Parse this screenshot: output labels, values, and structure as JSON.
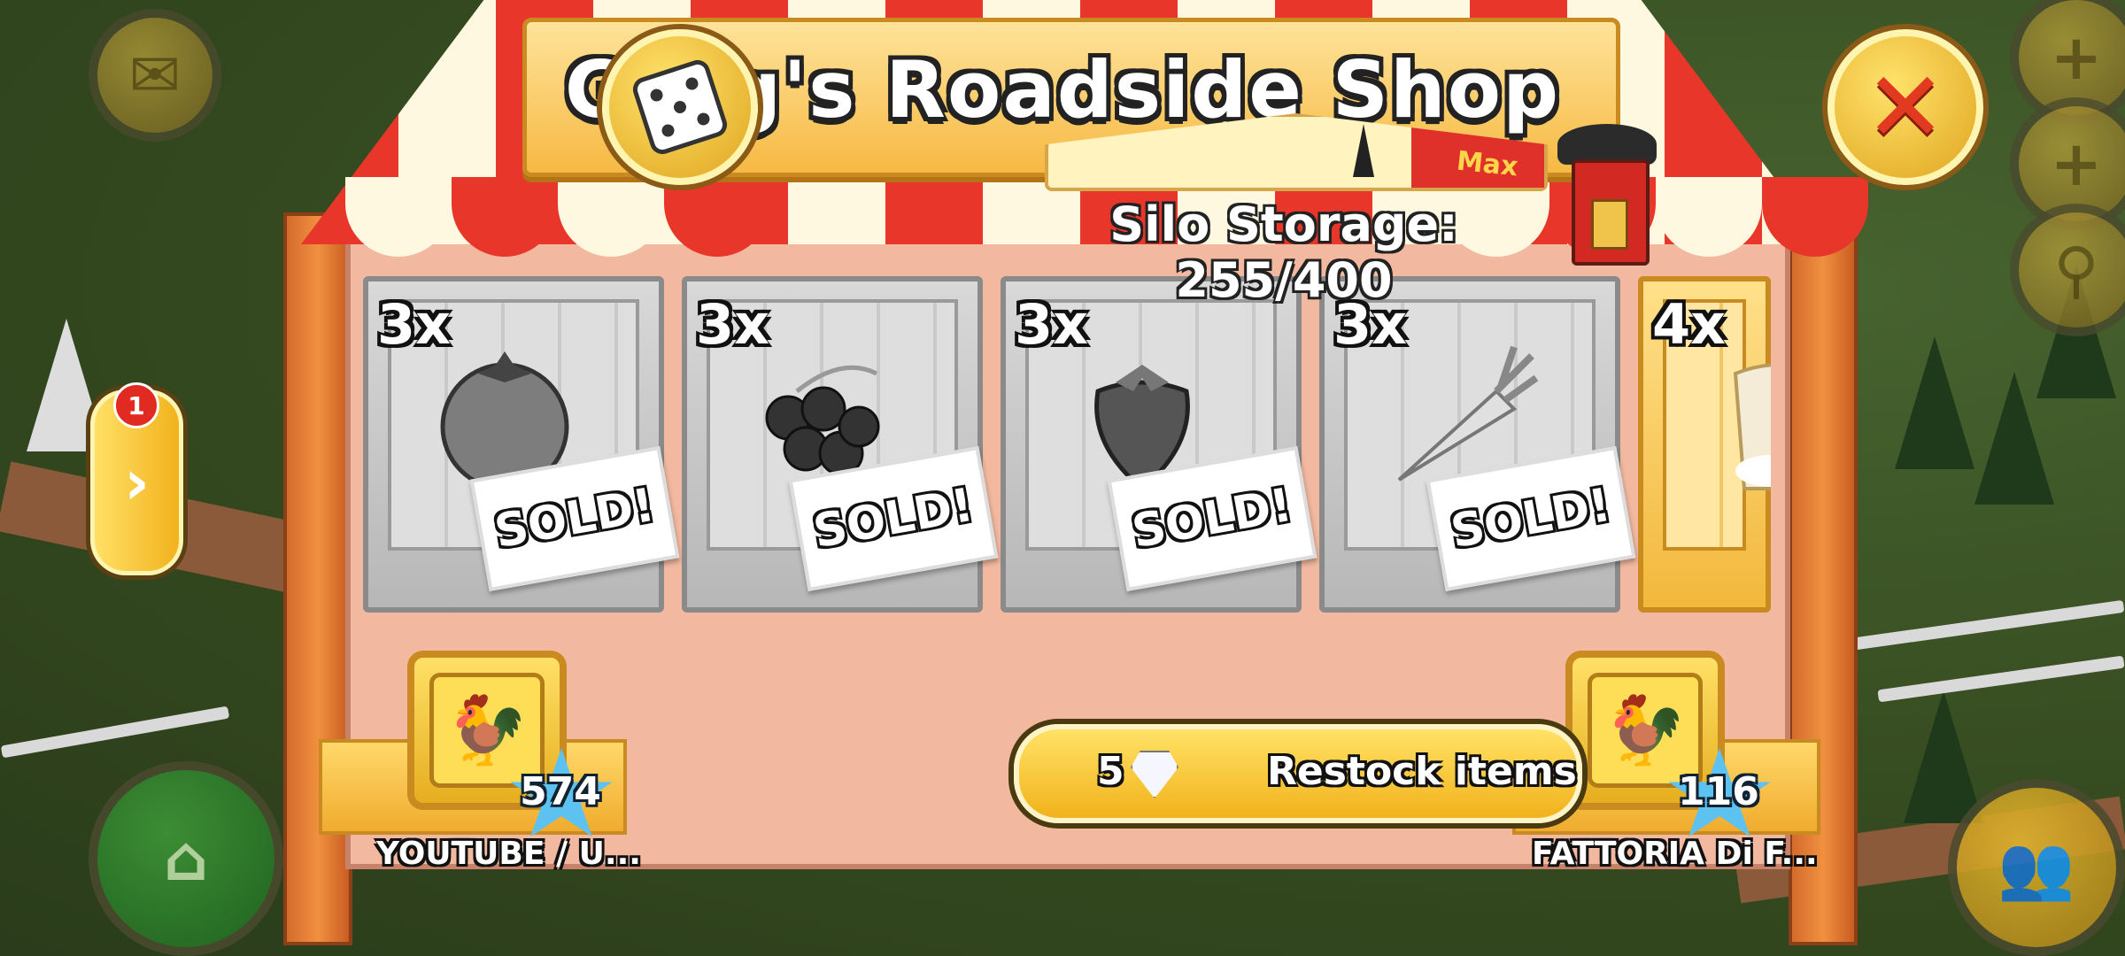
{
  "shop": {
    "title": "Greg's Roadside Shop",
    "silo_label": "Silo Storage: 255/400",
    "gauge_max_label": "Max",
    "silo_fill_fraction": 0.6375
  },
  "crates": [
    {
      "qty": "3x",
      "item": "tomato-icon",
      "status": "SOLD!",
      "sold": true
    },
    {
      "qty": "3x",
      "item": "blackberry-icon",
      "status": "SOLD!",
      "sold": true
    },
    {
      "qty": "3x",
      "item": "strawberry-icon",
      "status": "SOLD!",
      "sold": true
    },
    {
      "qty": "3x",
      "item": "carrot-icon",
      "status": "SOLD!",
      "sold": true
    },
    {
      "qty": "4x",
      "item": "sugar-sack-icon",
      "status": "",
      "sold": false
    }
  ],
  "restock": {
    "cost": "5",
    "label": "Restock items"
  },
  "friends": [
    {
      "name": "YOUTUBE / U...",
      "level": "574"
    },
    {
      "name": "FATTORIA Di F...",
      "level": "116"
    }
  ],
  "side_tab": {
    "notification_count": "1"
  },
  "colors": {
    "awning_red": "#e8362a",
    "awning_cream": "#fff8e0",
    "button_gold": "#f2b21c",
    "post_orange": "#f0903f",
    "counter_pink": "#f2b9a0"
  }
}
